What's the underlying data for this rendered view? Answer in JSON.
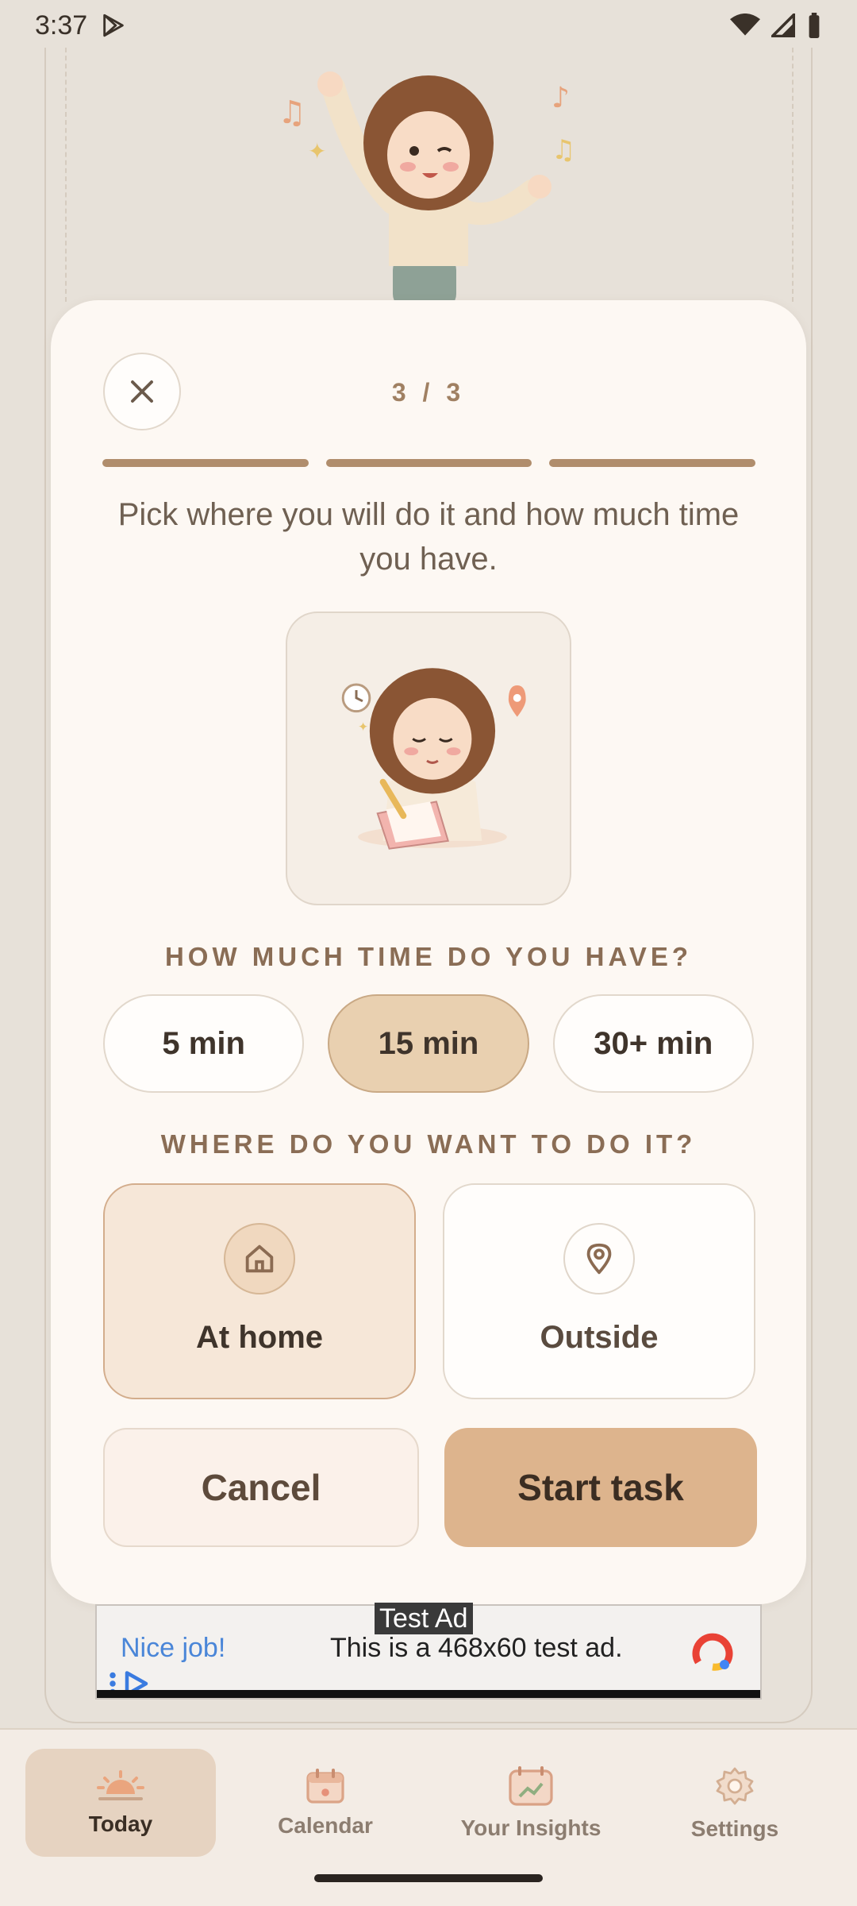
{
  "status_bar": {
    "time": "3:37"
  },
  "sheet": {
    "step": "3 / 3",
    "description": "Pick where you will do it and how much time you have.",
    "time_section": {
      "title": "HOW MUCH TIME DO YOU HAVE?",
      "options": [
        "5 min",
        "15 min",
        "30+ min"
      ],
      "selected": "15 min"
    },
    "place_section": {
      "title": "WHERE DO YOU WANT TO DO IT?",
      "options": [
        {
          "label": "At home",
          "icon": "home-icon"
        },
        {
          "label": "Outside",
          "icon": "location-pin-icon"
        }
      ],
      "selected": "At home"
    },
    "actions": {
      "cancel": "Cancel",
      "start": "Start task"
    }
  },
  "ad": {
    "tag": "Test Ad",
    "headline": "Nice job!",
    "message": "This is a 468x60 test ad."
  },
  "nav": {
    "items": [
      {
        "label": "Today",
        "icon": "sunrise-icon"
      },
      {
        "label": "Calendar",
        "icon": "calendar-icon"
      },
      {
        "label": "Your Insights",
        "icon": "insights-icon"
      },
      {
        "label": "Settings",
        "icon": "gear-icon"
      }
    ],
    "active": "Today"
  },
  "colors": {
    "accent": "#ddb48d",
    "sheet_bg": "#fdf8f3",
    "selected_chip": "#e9d0b0"
  }
}
